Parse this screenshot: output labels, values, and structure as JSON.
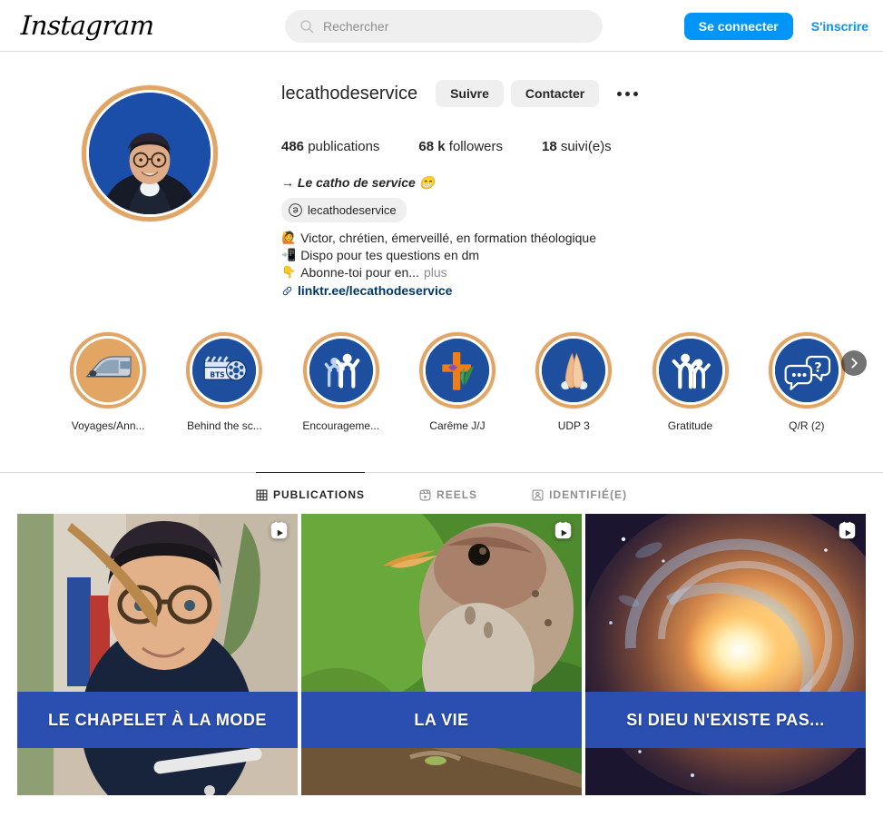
{
  "header": {
    "logo": "Instagram",
    "search": {
      "placeholder": "Rechercher",
      "value": "",
      "icon": "search-icon"
    },
    "login_label": "Se connecter",
    "signup_label": "S'inscrire",
    "accent_color": "#0095f6"
  },
  "profile": {
    "username": "lecathodeservice",
    "follow_label": "Suivre",
    "contact_label": "Contacter",
    "options_icon": "more-options-icon",
    "stats": [
      {
        "value": "486",
        "label": "publications"
      },
      {
        "value": "68 k",
        "label": "followers"
      },
      {
        "value": "18",
        "label": "suivi(e)s"
      }
    ],
    "bio_title": "→ Le catho de service 😁",
    "threads": {
      "icon": "threads-icon",
      "handle": "lecathodeservice"
    },
    "bio_lines": [
      {
        "emoji": "🙋",
        "text": "Victor, chrétien, émerveillé, en formation théologique"
      },
      {
        "emoji": "📲",
        "text": "Dispo pour tes questions en dm"
      },
      {
        "emoji": "👇",
        "text": "Abonne-toi pour en...",
        "more": "plus"
      }
    ],
    "link": {
      "icon": "link-icon",
      "text": "linktr.ee/lecathodeservice"
    },
    "ring_color": "#e2a564",
    "avatar_bg": "#1a4ea8"
  },
  "highlights": {
    "next_icon": "chevron-right-icon",
    "items": [
      {
        "label": "Voyages/Ann...",
        "cover": "train-icon",
        "cover_bg": "tan"
      },
      {
        "label": "Behind the sc...",
        "cover": "clapperboard-icon",
        "cover_bg": "blue"
      },
      {
        "label": "Encourageme...",
        "cover": "cheering-people-icon",
        "cover_bg": "blue"
      },
      {
        "label": "Carême J/J",
        "cover": "cross-palm-icon",
        "cover_bg": "blue"
      },
      {
        "label": "UDP 3",
        "cover": "praying-hands-icon",
        "cover_bg": "blue"
      },
      {
        "label": "Gratitude",
        "cover": "raised-arms-icon",
        "cover_bg": "blue"
      },
      {
        "label": "Q/R (2)",
        "cover": "speech-bubbles-icon",
        "cover_bg": "blue"
      }
    ]
  },
  "tabs": [
    {
      "label": "PUBLICATIONS",
      "icon": "grid-icon",
      "active": true
    },
    {
      "label": "REELS",
      "icon": "reels-icon",
      "active": false
    },
    {
      "label": "IDENTIFIÉ(E)",
      "icon": "tagged-icon",
      "active": false
    }
  ],
  "posts": [
    {
      "caption": "LE CHAPELET À LA MODE",
      "badge": "reels-icon",
      "art": "portrait"
    },
    {
      "caption": "LA VIE",
      "badge": "reels-icon",
      "art": "bird"
    },
    {
      "caption": "SI DIEU N'EXISTE PAS...",
      "badge": "reels-icon",
      "art": "galaxy"
    }
  ],
  "colors": {
    "caption_band": "#2b4fb0",
    "highlight_ring": "#e2a564",
    "instagram_blue": "#0095f6",
    "border": "#dbdbdb"
  }
}
